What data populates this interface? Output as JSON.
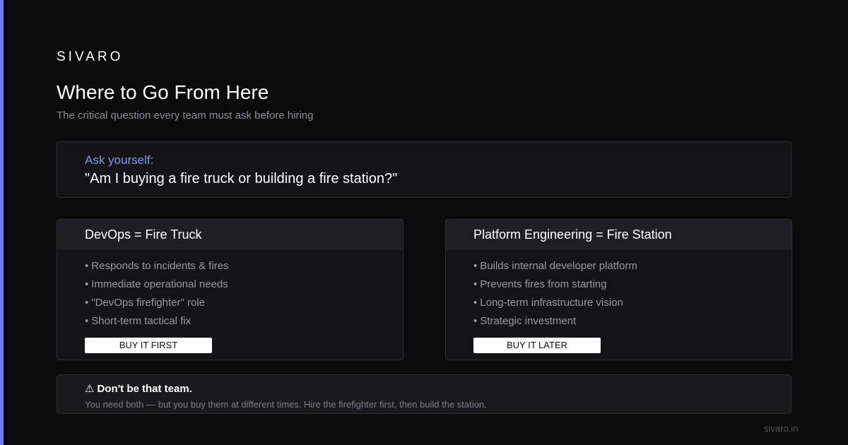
{
  "brand": "SIVARO",
  "header": {
    "title": "Where to Go From Here",
    "subtitle": "The critical question every team must ask before hiring"
  },
  "ask": {
    "label": "Ask yourself:",
    "question": "\"Am I buying a fire truck or building a fire station?\""
  },
  "cards": [
    {
      "title": "DevOps = Fire Truck",
      "items": [
        "Responds to incidents & fires",
        "Immediate operational needs",
        "\"DevOps firefighter\" role",
        "Short-term tactical fix"
      ],
      "button": "BUY IT FIRST"
    },
    {
      "title": "Platform Engineering = Fire Station",
      "items": [
        "Builds internal developer platform",
        "Prevents fires from starting",
        "Long-term infrastructure vision",
        "Strategic investment"
      ],
      "button": "BUY IT LATER"
    }
  ],
  "warning": {
    "icon": "warning-icon",
    "title": "Don't be that team.",
    "text": "You need both — but you buy them at different times. Hire the firefighter first, then build the station."
  },
  "footer": {
    "url": "sivaro.in"
  },
  "colors": {
    "accent": "#6f7bf7",
    "background": "#0b0b0c",
    "card": "#141417"
  }
}
